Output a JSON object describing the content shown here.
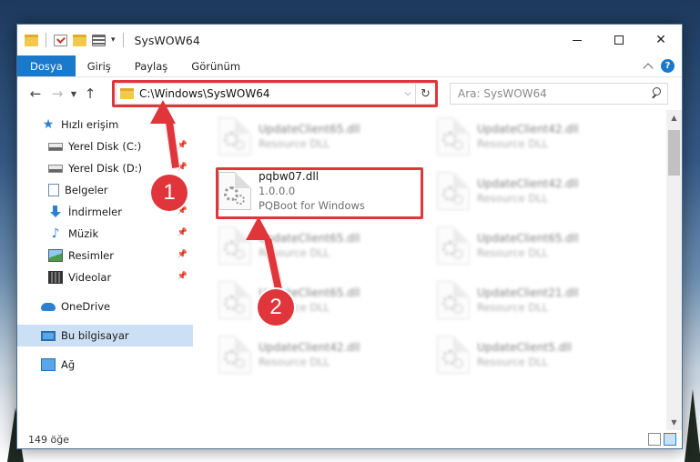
{
  "window": {
    "title": "SysWOW64"
  },
  "ribbon": {
    "tabs": [
      "Dosya",
      "Giriş",
      "Paylaş",
      "Görünüm"
    ],
    "help": "?"
  },
  "address_bar": {
    "path": "C:\\Windows\\SysWOW64",
    "search_placeholder": "Ara: SysWOW64"
  },
  "sidebar": {
    "items": [
      {
        "label": "Hızlı erişim",
        "icon": "star-icon"
      },
      {
        "label": "Yerel Disk (C:)",
        "icon": "drive-icon"
      },
      {
        "label": "Yerel Disk (D:)",
        "icon": "drive-icon"
      },
      {
        "label": "Belgeler",
        "icon": "documents-icon"
      },
      {
        "label": "İndirmeler",
        "icon": "downloads-icon"
      },
      {
        "label": "Müzik",
        "icon": "music-icon"
      },
      {
        "label": "Resimler",
        "icon": "pictures-icon"
      },
      {
        "label": "Videolar",
        "icon": "videos-icon"
      },
      {
        "label": "OneDrive",
        "icon": "cloud-icon"
      },
      {
        "label": "Bu bilgisayar",
        "icon": "computer-icon"
      },
      {
        "label": "Ağ",
        "icon": "network-icon"
      }
    ]
  },
  "files": {
    "highlighted": {
      "name": "pqbw07.dll",
      "version": "1.0.0.0",
      "description": "PQBoot for Windows"
    },
    "left_column": [
      {
        "name": "UpdateClient65.dll",
        "description": "Resource DLL"
      },
      {
        "name": "UpdateClient65.dll",
        "description": "Resource DLL"
      },
      {
        "name": "UpdateClient65.dll",
        "description": "Resource DLL"
      },
      {
        "name": "UpdateClient42.dll",
        "description": "Resource DLL"
      }
    ],
    "right_column": [
      {
        "name": "UpdateClient42.dll",
        "description": "Resource DLL"
      },
      {
        "name": "UpdateClient42.dll",
        "description": "Resource DLL"
      },
      {
        "name": "UpdateClient65.dll",
        "description": "Resource DLL"
      },
      {
        "name": "UpdateClient21.dll",
        "description": "Resource DLL"
      },
      {
        "name": "UpdateClient5.dll",
        "description": "Resource DLL"
      }
    ]
  },
  "status": {
    "count": "149 öğe"
  },
  "annotations": {
    "step1": "1",
    "step2": "2",
    "color": "#e0353a"
  }
}
